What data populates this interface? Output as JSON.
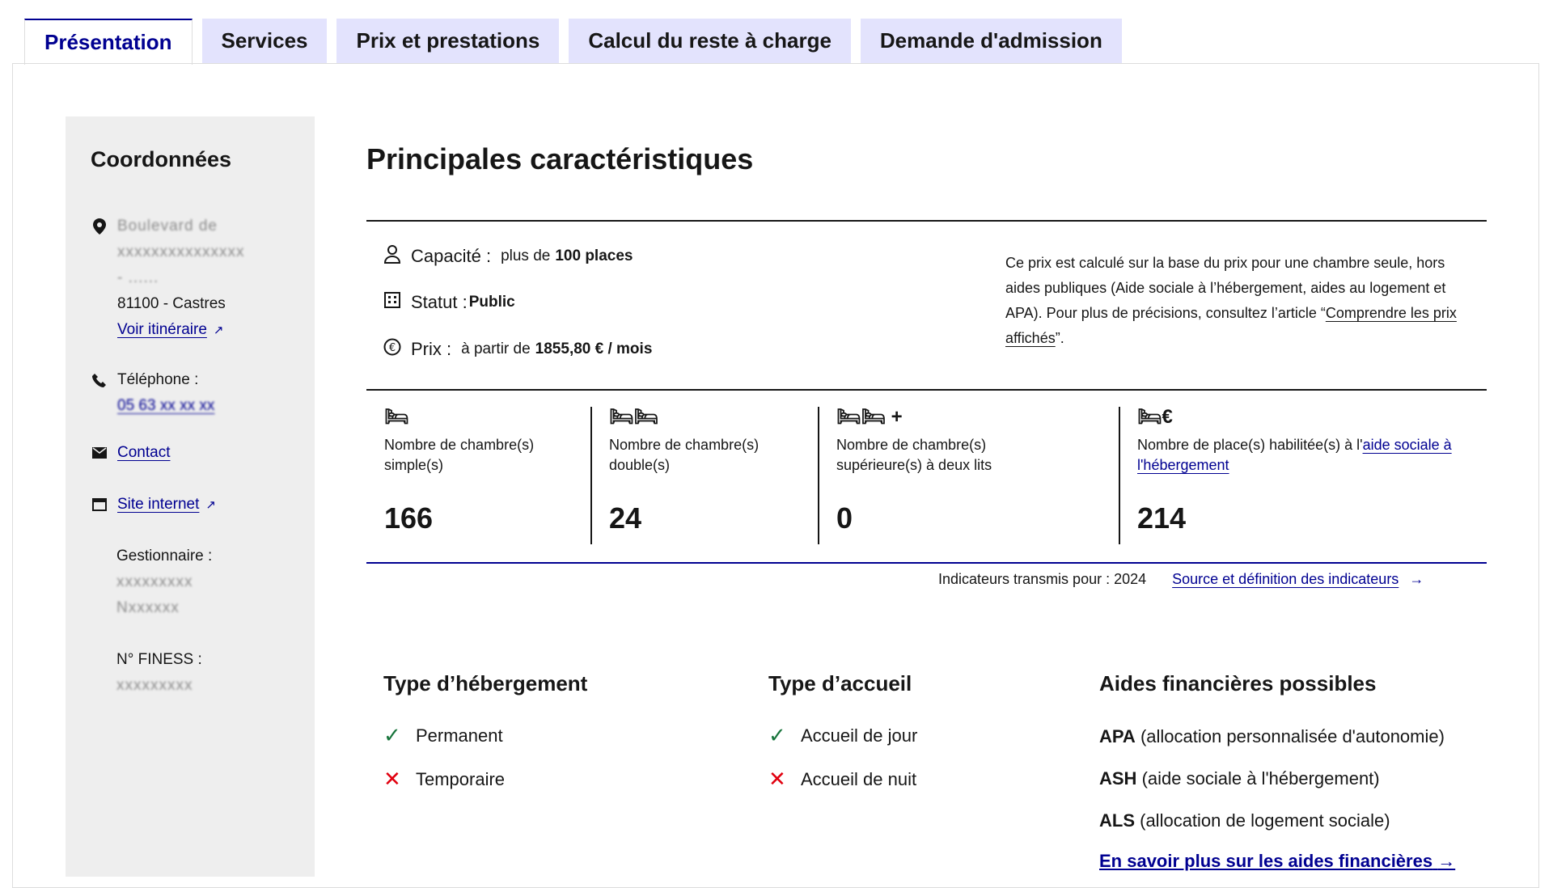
{
  "tabs": [
    "Présentation",
    "Services",
    "Prix et prestations",
    "Calcul du reste à charge",
    "Demande d'admission"
  ],
  "sidebar": {
    "title": "Coordonnées",
    "address_line1": "Boulevard de",
    "address_line2": "xxxxxxxxxxxxxxx",
    "address_line3": "- ......",
    "city": "81100 - Castres",
    "itinerary_link": "Voir itinéraire",
    "phone_label": "Téléphone :",
    "phone_value": "05 63 xx xx xx",
    "contact_link": "Contact",
    "website_link": "Site internet",
    "manager_label": "Gestionnaire :",
    "manager_line1": "xxxxxxxxx",
    "manager_line2": "Nxxxxxx",
    "finess_label": "N° FINESS :",
    "finess_value": "xxxxxxxxx"
  },
  "main": {
    "title": "Principales caractéristiques",
    "capacity_label": "Capacité :",
    "capacity_prefix": "plus de",
    "capacity_value": "100 places",
    "status_label": "Statut :",
    "status_value": "Public",
    "price_label": "Prix :",
    "price_prefix": "à partir de",
    "price_value": "1855,80 € / mois",
    "note_text": "Ce prix est calculé sur la base du prix pour une chambre seule, hors aides publiques (Aide sociale à l’hébergement, aides au logement et APA). Pour plus de précisions, consultez l’article “",
    "note_link": "Comprendre les prix affichés",
    "note_end": "”.",
    "stats": [
      {
        "label": "Nombre de chambre(s) simple(s)",
        "value": "166"
      },
      {
        "label": "Nombre de chambre(s) double(s)",
        "value": "24"
      },
      {
        "label": "Nombre de chambre(s) supérieure(s) à deux lits",
        "value": "0"
      },
      {
        "label_prefix": "Nombre de place(s) habilitée(s) à l'",
        "label_link": "aide sociale à l'hébergement",
        "value": "214"
      }
    ],
    "indicators_text": "Indicateurs transmis pour : 2024",
    "indicators_link": "Source et définition des indicateurs",
    "hosting_title": "Type d’hébergement",
    "hosting_items": [
      "Permanent",
      "Temporaire"
    ],
    "reception_title": "Type d’accueil",
    "reception_items": [
      "Accueil de jour",
      "Accueil de nuit"
    ],
    "aids_title": "Aides financières possibles",
    "aids": [
      {
        "abbr": "APA",
        "text": "(allocation personnalisée d'autonomie)"
      },
      {
        "abbr": "ASH",
        "text": "(aide sociale à l'hébergement)"
      },
      {
        "abbr": "ALS",
        "text": "(allocation de logement sociale)"
      }
    ],
    "aids_link": "En savoir plus sur les aides financières"
  },
  "colors": {
    "blue": "#000091",
    "check": "#18753c",
    "cross": "#e1000f",
    "tab_bg": "#e3e3fd",
    "sidebar_bg": "#eeeeee"
  },
  "icons": [
    "map-pin-icon",
    "phone-icon",
    "mail-icon",
    "calendar-icon",
    "user-icon",
    "building-icon",
    "euro-icon",
    "bed-icon",
    "check-icon",
    "cross-icon",
    "arrow-right-icon",
    "external-link-icon"
  ]
}
